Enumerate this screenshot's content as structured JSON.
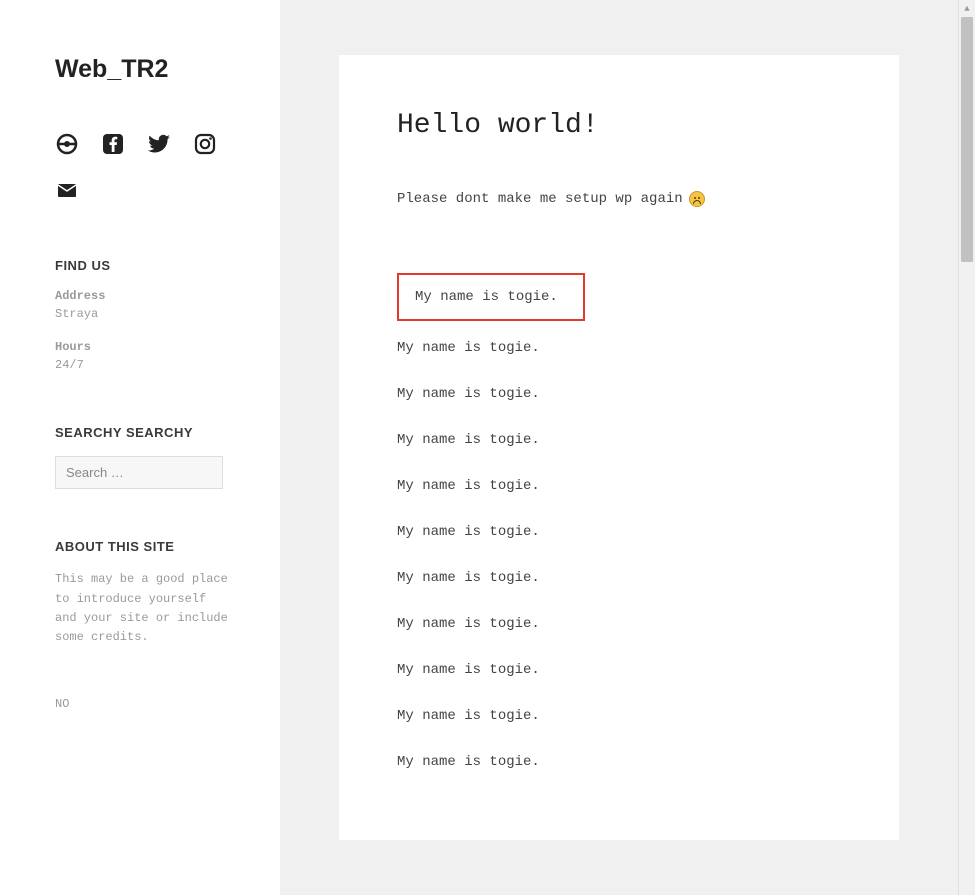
{
  "site": {
    "title": "Web_TR2"
  },
  "social": {
    "icons": [
      "pokeball-icon",
      "facebook-icon",
      "twitter-icon",
      "instagram-icon",
      "mail-icon"
    ]
  },
  "widgets": {
    "findus": {
      "title": "FIND US",
      "address_label": "Address",
      "address_value": "Straya",
      "hours_label": "Hours",
      "hours_value": "24/7"
    },
    "search": {
      "title": "SEARCHY SEARCHY",
      "placeholder": "Search …"
    },
    "about": {
      "title": "ABOUT THIS SITE",
      "text": "This may be a good place to introduce yourself and your site or include some credits."
    },
    "footer_text": "NO"
  },
  "post": {
    "title": "Hello world!",
    "lead": "Please dont make me setup wp again",
    "lines": [
      "My name is togie.",
      "My name is togie.",
      "My name is togie.",
      "My name is togie.",
      "My name is togie.",
      "My name is togie.",
      "My name is togie.",
      "My name is togie.",
      "My name is togie.",
      "My name is togie.",
      "My name is togie."
    ]
  }
}
